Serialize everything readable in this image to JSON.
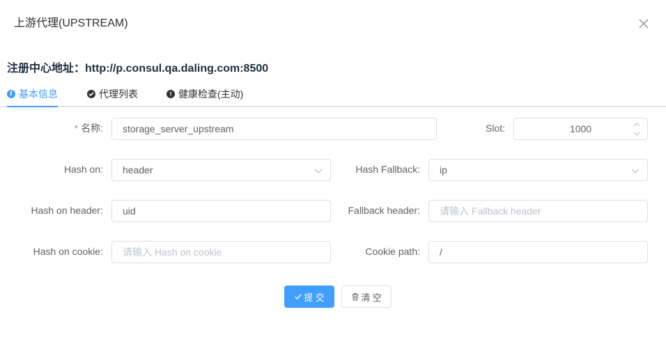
{
  "dialog": {
    "title": "上游代理(UPSTREAM)",
    "close_icon": "close-icon"
  },
  "registry": {
    "text": "注册中心地址：http://p.consul.qa.daling.com:8500"
  },
  "tabs": [
    {
      "label": "基本信息",
      "icon": "info-icon",
      "active": true
    },
    {
      "label": "代理列表",
      "icon": "check-circle-icon",
      "active": false
    },
    {
      "label": "健康检查(主动)",
      "icon": "warning-circle-icon",
      "active": false
    }
  ],
  "form": {
    "name": {
      "label": "名称:",
      "required": true,
      "value": "storage_server_upstream"
    },
    "slot": {
      "label": "Slot:",
      "value": "1000"
    },
    "hash_on": {
      "label": "Hash on:",
      "value": "header"
    },
    "hash_fallback": {
      "label": "Hash Fallback:",
      "value": "ip"
    },
    "hash_on_header": {
      "label": "Hash on header:",
      "value": "uid"
    },
    "fallback_header": {
      "label": "Fallback header:",
      "value": "",
      "placeholder": "请输入 Fallback header"
    },
    "hash_on_cookie": {
      "label": "Hash on cookie:",
      "value": "",
      "placeholder": "请输入 Hash on cookie"
    },
    "cookie_path": {
      "label": "Cookie path:",
      "value": "/"
    }
  },
  "buttons": {
    "submit": "提 交",
    "clear": "清 空"
  },
  "colors": {
    "primary": "#409eff",
    "required": "#f56c6c",
    "border": "#dcdfe6",
    "placeholder": "#c0c4cc"
  }
}
